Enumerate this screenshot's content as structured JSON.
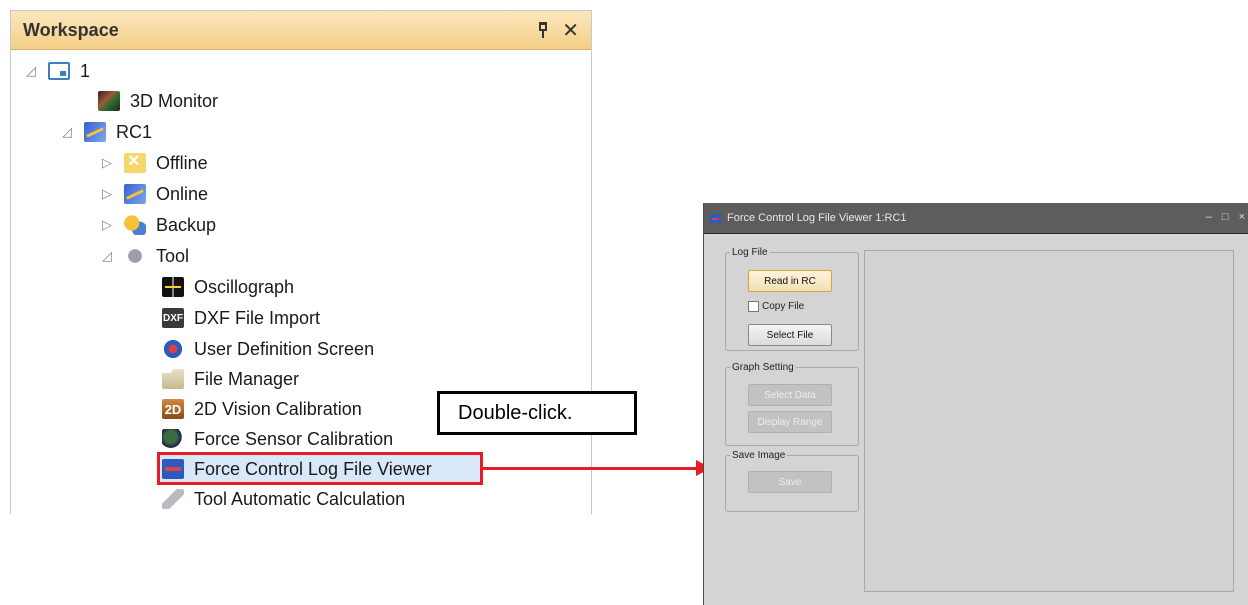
{
  "workspace": {
    "title": "Workspace",
    "close_glyph": "✕",
    "tree": [
      {
        "label": "1",
        "icon": "project-icon",
        "expander": "◿"
      },
      {
        "label": "3D Monitor",
        "icon": "3d-monitor-icon"
      },
      {
        "label": "RC1",
        "icon": "robot-controller-icon",
        "expander": "◿"
      },
      {
        "label": "Offline",
        "icon": "offline-icon",
        "expander": "▷"
      },
      {
        "label": "Online",
        "icon": "online-icon",
        "expander": "▷"
      },
      {
        "label": "Backup",
        "icon": "backup-icon",
        "expander": "▷"
      },
      {
        "label": "Tool",
        "icon": "tool-icon",
        "expander": "◿"
      },
      {
        "label": "Oscillograph",
        "icon": "oscillograph-icon"
      },
      {
        "label": "DXF File Import",
        "icon": "dxf-icon",
        "icon_text": "DXF"
      },
      {
        "label": "User Definition Screen",
        "icon": "user-definition-icon"
      },
      {
        "label": "File Manager",
        "icon": "folder-icon"
      },
      {
        "label": "2D Vision Calibration",
        "icon": "2d-vision-icon",
        "icon_text": "2D"
      },
      {
        "label": "Force Sensor Calibration",
        "icon": "force-sensor-icon"
      },
      {
        "label": "Force Control Log File Viewer",
        "icon": "log-viewer-icon",
        "selected": true
      },
      {
        "label": "Tool Automatic Calculation",
        "icon": "pencil-icon"
      }
    ]
  },
  "callout": {
    "text": "Double-click."
  },
  "viewer": {
    "title": "Force Control Log File Viewer 1:RC1",
    "controls": {
      "minimize": "–",
      "maximize": "□",
      "close": "×"
    },
    "log_file": {
      "legend": "Log File",
      "read_label": "Read in RC",
      "copy_label": "Copy File",
      "select_label": "Select File"
    },
    "graph_setting": {
      "legend": "Graph Setting",
      "select_data_label": "Select Data",
      "display_range_label": "Display Range"
    },
    "save_image": {
      "legend": "Save Image",
      "save_label": "Save"
    }
  },
  "colors": {
    "highlight": "#e81c24",
    "header": "#f4cf86",
    "viewer_bg": "#d4d4d4"
  }
}
